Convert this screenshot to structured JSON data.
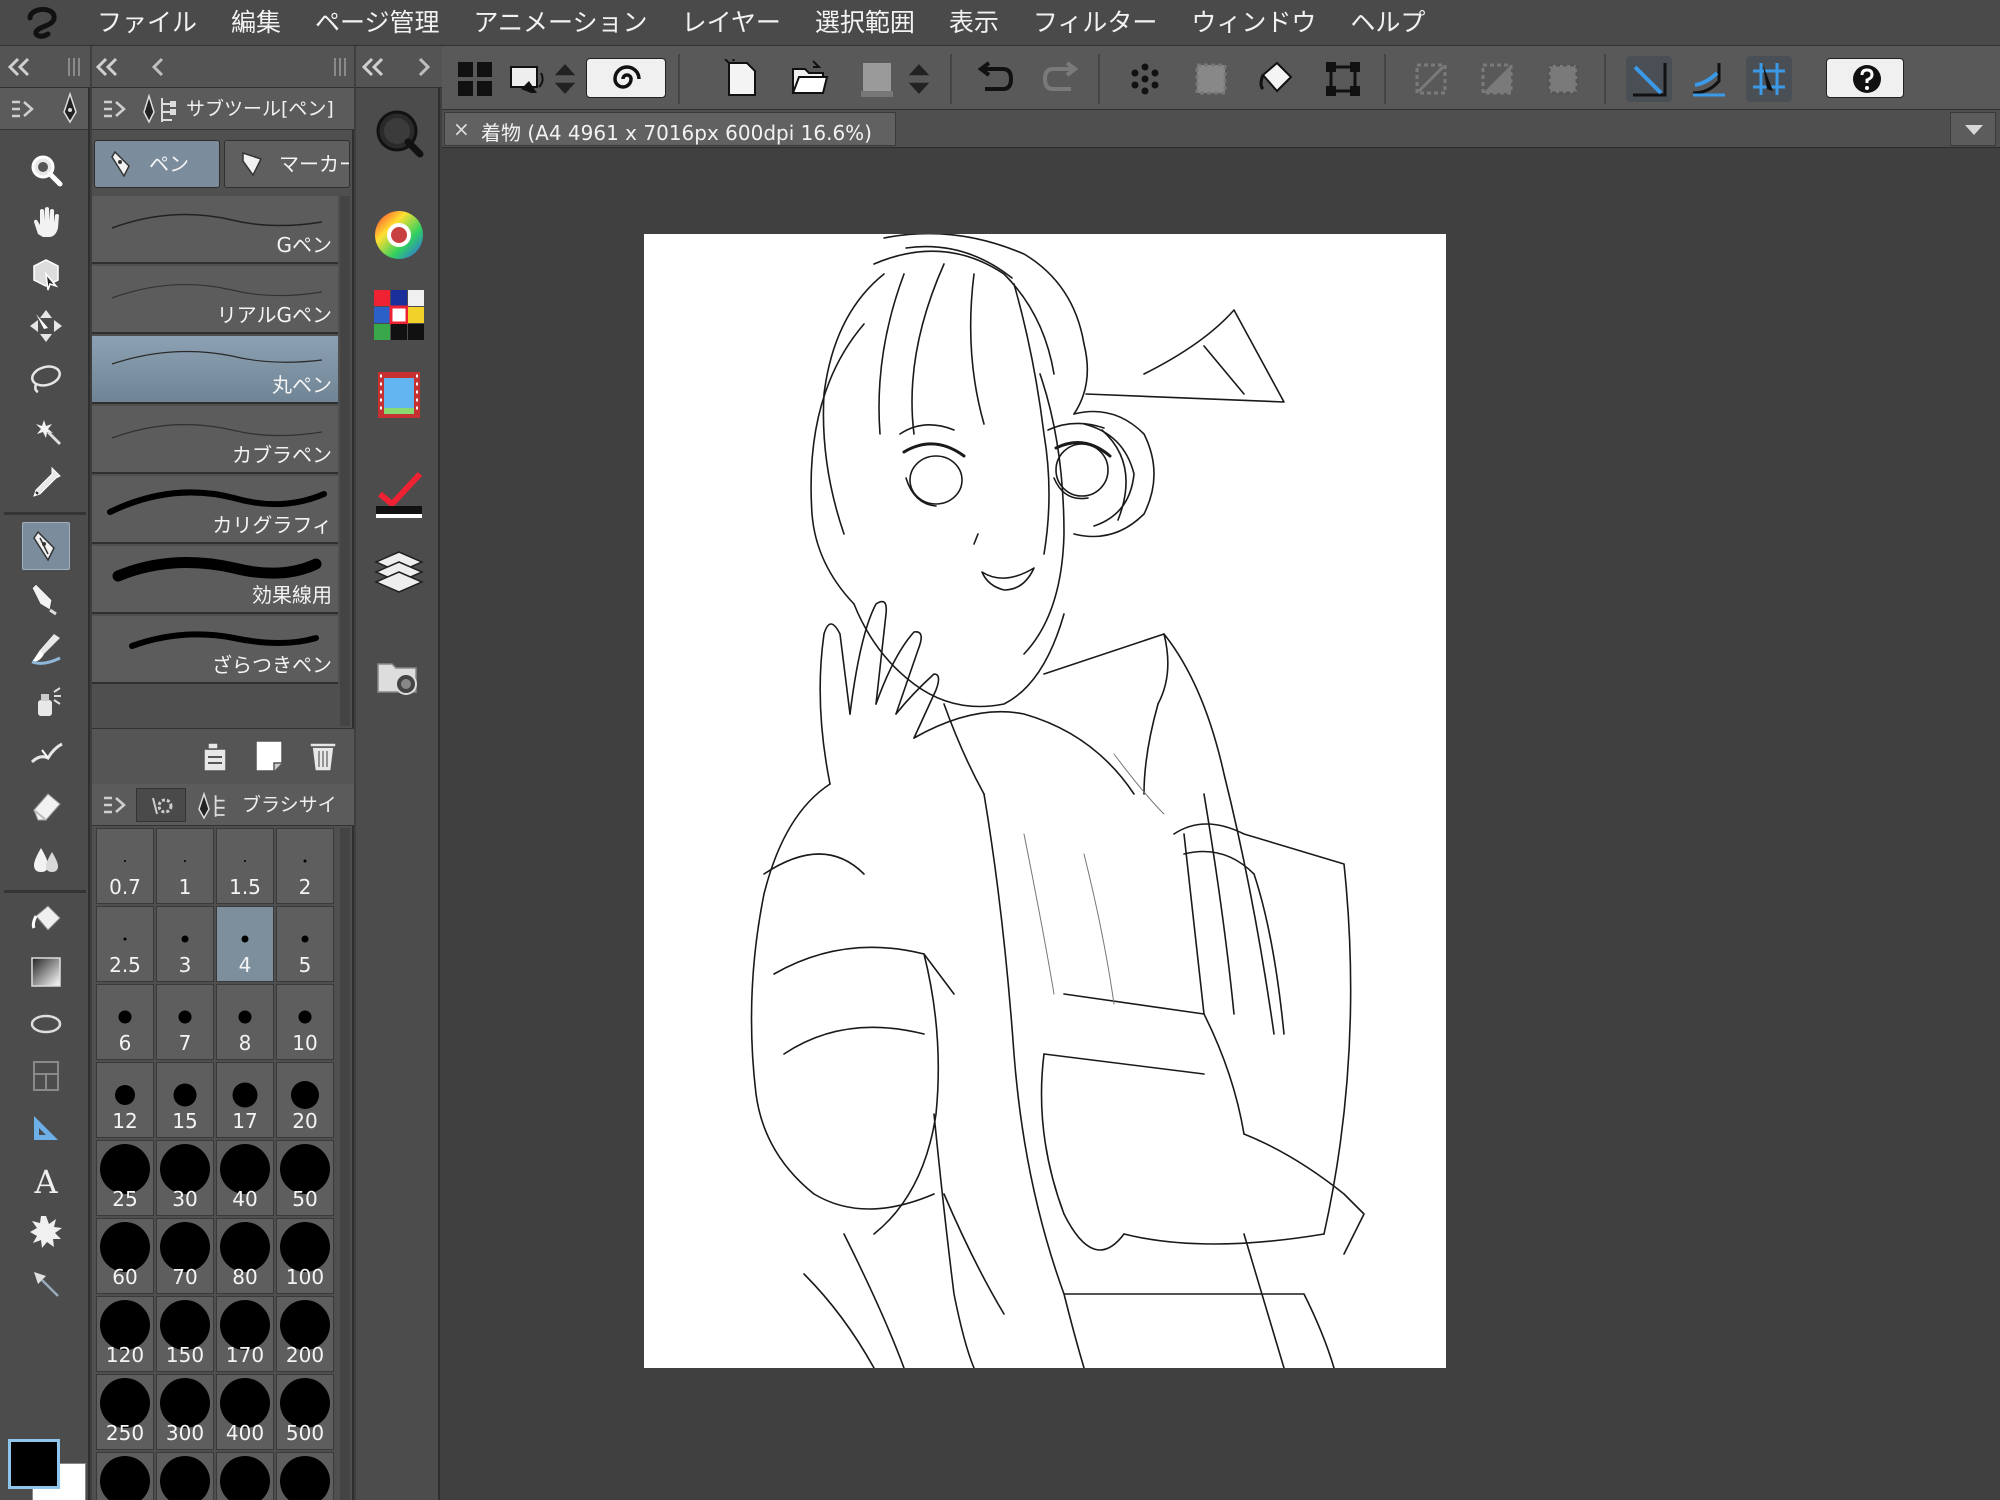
{
  "menubar": {
    "items": [
      "ファイル",
      "編集",
      "ページ管理",
      "アニメーション",
      "レイヤー",
      "選択範囲",
      "表示",
      "フィルター",
      "ウィンドウ",
      "ヘルプ"
    ]
  },
  "subtool_panel": {
    "title": "サブツール[ペン]",
    "tabs": [
      {
        "label": "ペン",
        "selected": true
      },
      {
        "label": "マーカー",
        "selected": false
      }
    ],
    "brushes": [
      {
        "label": "Gペン",
        "selected": false
      },
      {
        "label": "リアルGペン",
        "selected": false
      },
      {
        "label": "丸ペン",
        "selected": true
      },
      {
        "label": "カブラペン",
        "selected": false
      },
      {
        "label": "カリグラフィ",
        "selected": false
      },
      {
        "label": "効果線用",
        "selected": false
      },
      {
        "label": "ざらつきペン",
        "selected": false
      }
    ]
  },
  "brush_size_panel": {
    "title": "ブラシサイ",
    "selected": "4",
    "sizes": [
      "0.7",
      "1",
      "1.5",
      "2",
      "2.5",
      "3",
      "4",
      "5",
      "6",
      "7",
      "8",
      "10",
      "12",
      "15",
      "17",
      "20",
      "25",
      "30",
      "40",
      "50",
      "60",
      "70",
      "80",
      "100",
      "120",
      "150",
      "170",
      "200",
      "250",
      "300",
      "400",
      "500",
      "",
      "",
      "",
      ""
    ]
  },
  "document_tab": {
    "close_glyph": "×",
    "title": "着物 (A4 4961 x 7016px 600dpi 16.6%)"
  },
  "colors": {
    "main": "#000000",
    "sub": "#ffffff",
    "selection_accent": "#7b8d9c"
  }
}
